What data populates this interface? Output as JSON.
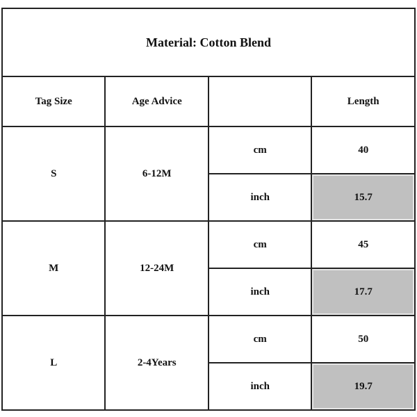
{
  "table": {
    "title": "Material: Cotton Blend",
    "headers": [
      "Tag Size",
      "Age Advice",
      "",
      "Length"
    ],
    "rows": [
      {
        "tag_size": "S",
        "age": "6-12M",
        "cm_label": "cm",
        "cm_value": "40",
        "inch_label": "inch",
        "inch_value": "15.7"
      },
      {
        "tag_size": "M",
        "age": "12-24M",
        "cm_label": "cm",
        "cm_value": "45",
        "inch_label": "inch",
        "inch_value": "17.7"
      },
      {
        "tag_size": "L",
        "age": "2-4Years",
        "cm_label": "cm",
        "cm_value": "50",
        "inch_label": "inch",
        "inch_value": "19.7"
      }
    ],
    "shade_color": "#c0c0c0"
  }
}
